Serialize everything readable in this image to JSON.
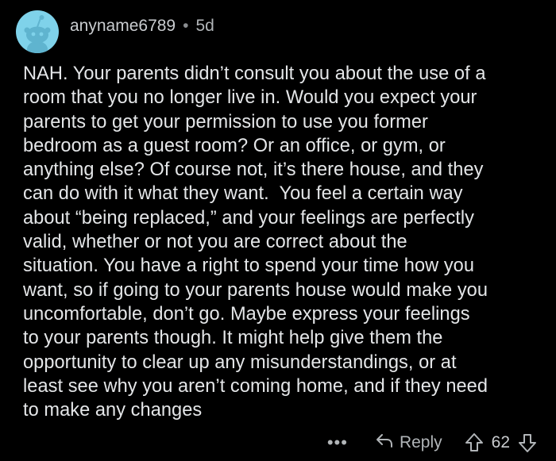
{
  "comment": {
    "author": "anyname6789",
    "separator": "•",
    "age": "5d",
    "body": "NAH. Your parents didn’t consult you about the use of a\nroom that you no longer live in. Would you expect your\nparents to get your permission to use you former\nbedroom as a guest room? Or an office, or gym, or\nanything else? Of course not, it’s there house, and they\ncan do with it what they want.  You feel a certain way\nabout “being replaced,” and your feelings are perfectly\nvalid, whether or not you are correct about the\nsituation. You have a right to spend your time how you\nwant, so if going to your parents house would make you\nuncomfortable, don’t go. Maybe express your feelings\nto your parents though. It might help give them the\nopportunity to clear up any misunderstandings, or at\nleast see why you aren’t coming home, and if they need\nto make any changes",
    "actions": {
      "more": "•••",
      "reply_label": "Reply",
      "score": "62"
    },
    "icons": {
      "avatar": "snoo-avatar-icon",
      "reply": "reply-arrow-icon",
      "upvote": "upvote-arrow-icon",
      "downvote": "downvote-arrow-icon"
    },
    "colors": {
      "background": "#000000",
      "avatar_bg": "#7fd2ea",
      "text": "#e4e6e8",
      "muted": "#b1b5b8"
    }
  }
}
